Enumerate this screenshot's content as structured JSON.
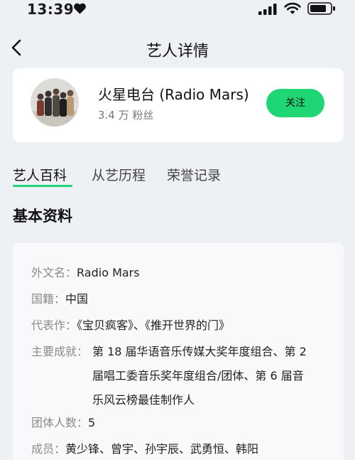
{
  "status_bar": {
    "time": "13:39",
    "accent_color": "#111111"
  },
  "nav": {
    "title": "艺人详情"
  },
  "artist": {
    "name": "火星电台 (Radio Mars)",
    "fans": "3.4 万 粉丝",
    "follow_label": "关注",
    "follow_color": "#1fd675"
  },
  "tabs": [
    {
      "label": "艺人百科",
      "active": true
    },
    {
      "label": "从艺历程",
      "active": false
    },
    {
      "label": "荣誉记录",
      "active": false
    }
  ],
  "section_title": "基本资料",
  "info": {
    "foreign_name": {
      "label": "外文名：",
      "value": "Radio Mars"
    },
    "nationality": {
      "label": "国籍：",
      "value": "中国"
    },
    "works": {
      "label": "代表作：",
      "value": "《宝贝疯客》、《推开世界的门》"
    },
    "achievements": {
      "label": "主要成就：",
      "lines": [
        "第 18 届华语音乐传媒大奖年度组合、第 2",
        "届唱工委音乐奖年度组合/团体、第 6 届音",
        "乐风云榜最佳制作人"
      ]
    },
    "member_count": {
      "label": "团体人数：",
      "value": "5"
    },
    "members": {
      "label": "成员：",
      "value": "黄少锋、曾宇、孙宇辰、武勇恒、韩阳"
    }
  }
}
